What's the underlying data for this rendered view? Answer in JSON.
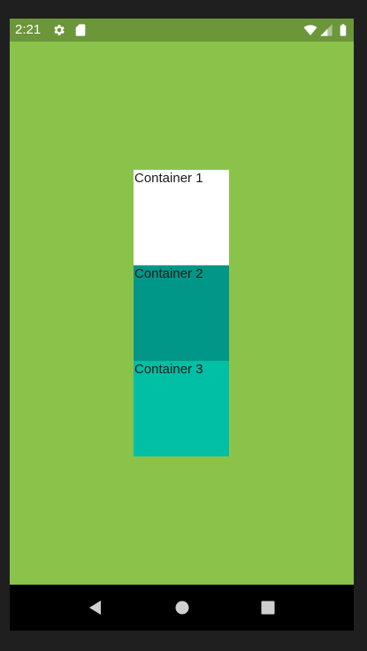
{
  "status_bar": {
    "time": "2:21",
    "icons": [
      "settings-icon",
      "sd-card-icon",
      "wifi-icon",
      "signal-icon",
      "battery-icon"
    ]
  },
  "colors": {
    "status_bar": "#6b963a",
    "background": "#8bc34a",
    "container_1": "#ffffff",
    "container_2": "#009688",
    "container_3": "#00bfa5"
  },
  "containers": [
    {
      "label": "Container 1"
    },
    {
      "label": "Container 2"
    },
    {
      "label": "Container 3"
    }
  ],
  "nav_bar": {
    "buttons": [
      "back-icon",
      "home-icon",
      "recents-icon"
    ]
  }
}
